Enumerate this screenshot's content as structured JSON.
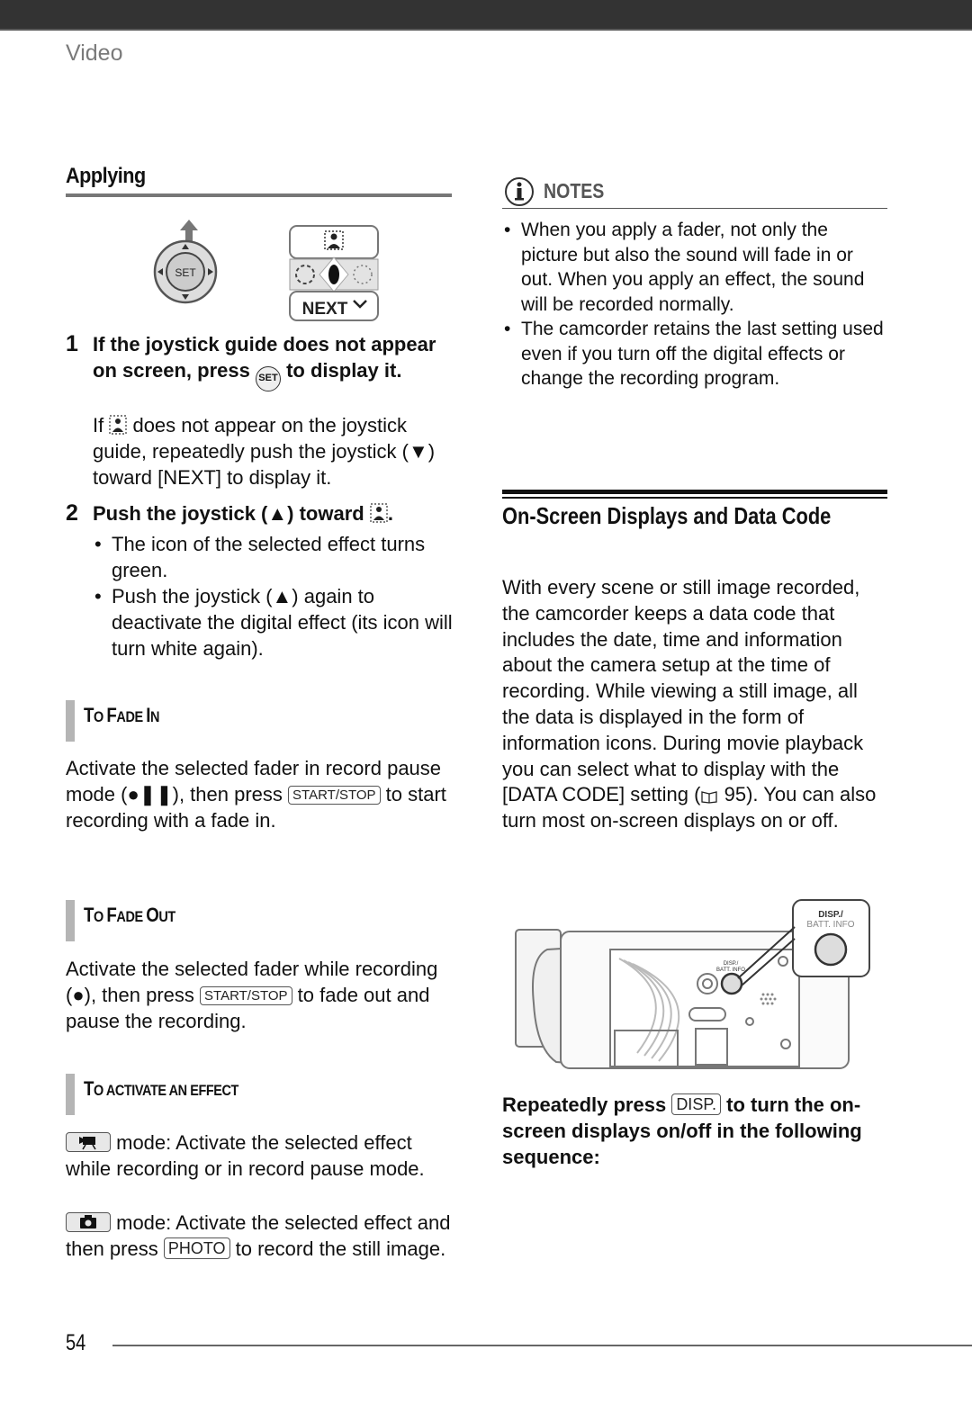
{
  "header": {
    "section": "Video"
  },
  "left": {
    "applying_title": "Applying",
    "figure": {
      "joystick_center": "SET",
      "guide_next": "NEXT"
    },
    "step1": {
      "num": "1",
      "title_a": "If the joystick guide does not appear on screen, press ",
      "set_label": "SET",
      "title_b": " to display it.",
      "body_a": "If ",
      "body_b": " does not appear on the joystick guide, repeatedly push the joystick (▼) toward [NEXT] to display it."
    },
    "step2": {
      "num": "2",
      "title_a": "Push the joystick (▲) toward ",
      "title_b": ".",
      "bullets": [
        "The icon of the selected effect turns green.",
        "Push the joystick (▲) again to deactivate the digital effect (its icon will turn white again)."
      ]
    },
    "fade_in": {
      "head_big1": "T",
      "head_sm1": "O ",
      "head_big2": "F",
      "head_sm2": "ADE ",
      "head_big3": "I",
      "head_sm3": "N",
      "text_a": "Activate the selected fader in record pause mode (●❚❚), then press ",
      "key": "START/STOP",
      "text_b": " to start recording with a fade in."
    },
    "fade_out": {
      "head_big1": "T",
      "head_sm1": "O ",
      "head_big2": "F",
      "head_sm2": "ADE ",
      "head_big3": "O",
      "head_sm3": "UT",
      "text_a": "Activate the selected fader while recording (●), then press ",
      "key": "START/STOP",
      "text_b": " to fade out and pause the recording."
    },
    "activate": {
      "head_big1": "T",
      "head_sm1": "O ACTIVATE AN EFFECT",
      "movie_text": " mode: Activate the selected effect while recording or in record pause mode.",
      "photo_text_a": " mode: Activate the selected effect and then press ",
      "photo_key": "PHOTO",
      "photo_text_b": " to record the still image."
    }
  },
  "right": {
    "notes_title": "NOTES",
    "notes": [
      "When you apply a fader, not only the picture but also the sound will fade in or out. When you apply an effect, the sound will be recorded normally.",
      "The camcorder retains the last setting used even if you turn off the digital effects or change the recording program."
    ],
    "osd_title": "On-Screen Displays and Data Code",
    "osd_body_a": "With every scene or still image recorded, the camcorder keeps a data code that includes the date, time and information about the camera setup at the time of recording. While viewing a still image, all the data is displayed in the form of information icons. During movie playback you can select what to display with the [DATA CODE] setting (",
    "osd_ref": " 95",
    "osd_body_b": "). You can also turn most on-screen displays on or off.",
    "figure": {
      "callout_line1": "DISP./",
      "callout_line2": "BATT. INFO",
      "body_line1": "DISP./",
      "body_line2": "BATT. INFO"
    },
    "instr_a": "Repeatedly press ",
    "instr_key": "DISP.",
    "instr_b": " to turn the on-screen displays on/off in the following sequence:"
  },
  "footer": {
    "page_number": "54"
  }
}
